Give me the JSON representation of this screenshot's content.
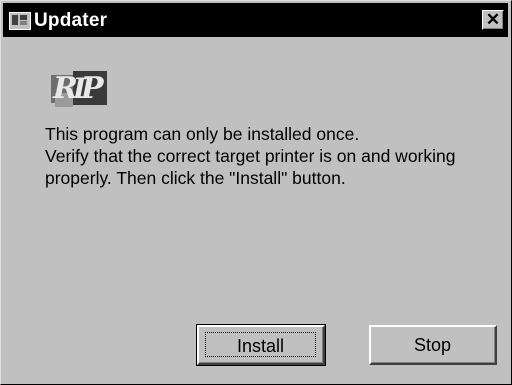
{
  "window": {
    "title": "Updater",
    "app_icon": "updater-app-icon",
    "close_label": "✕"
  },
  "logo": {
    "letters": [
      "R",
      "I",
      "P"
    ],
    "icon": "rip-logo-icon"
  },
  "message": {
    "line1": "This program can only be installed once.",
    "line2": "Verify that the correct target printer is on and working",
    "line3": "properly. Then click the \"Install\" button."
  },
  "buttons": {
    "install_label": "Install",
    "stop_label": "Stop"
  }
}
